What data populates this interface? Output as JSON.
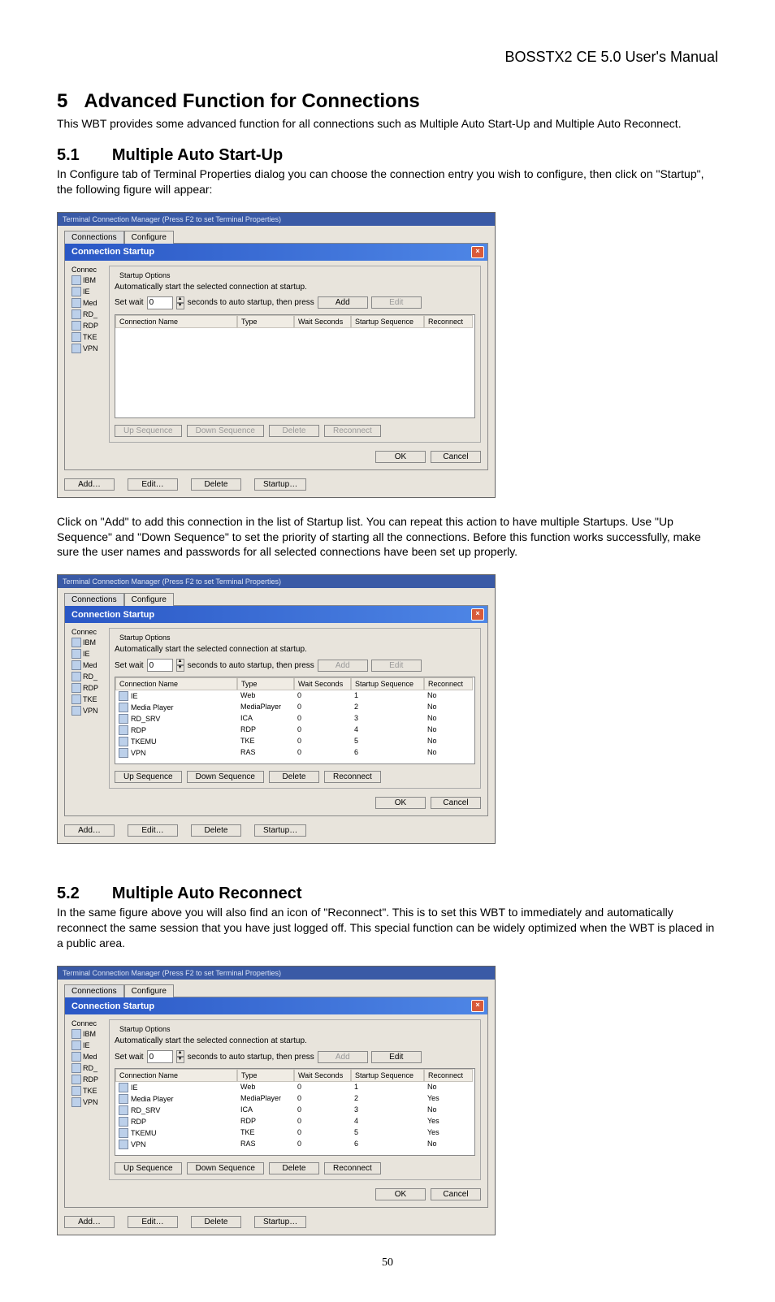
{
  "doc_header": "BOSSTX2 CE 5.0 User's Manual",
  "section5": {
    "num": "5",
    "title": "Advanced Function for Connections",
    "intro": "This WBT provides some advanced function for all connections such as Multiple Auto Start-Up and Multiple Auto Reconnect."
  },
  "section51": {
    "num": "5.1",
    "title": "Multiple Auto Start-Up",
    "intro": "In Configure tab of Terminal Properties dialog you can choose the connection entry you wish to configure, then click on \"Startup\", the following figure will appear:",
    "after": "Click on \"Add\" to add this connection in the list of Startup list. You can repeat this action to have multiple Startups. Use \"Up Sequence\" and \"Down Sequence\" to set the priority of starting all the connections. Before this function works successfully, make sure the user names and passwords for all selected connections have been set up properly."
  },
  "section52": {
    "num": "5.2",
    "title": "Multiple Auto Reconnect",
    "intro": "In the same figure above you will also find an icon of \"Reconnect\". This is to set this WBT to immediately and automatically reconnect the same session that you have just logged off. This special function can be widely optimized when the WBT is placed in a public area."
  },
  "tcm": {
    "window_title": "Terminal Connection Manager  (Press F2 to set Terminal Properties)",
    "tab_connections": "Connections",
    "tab_configure": "Configure",
    "dialog_title": "Connection Startup",
    "group_label": "Startup Options",
    "auto_text": "Automatically start the selected connection at startup.",
    "set_wait_label": "Set wait",
    "set_wait_value": "0",
    "set_wait_tail": "seconds to auto startup, then press",
    "add": "Add",
    "edit": "Edit",
    "list_headers": [
      "Connection Name",
      "Type",
      "Wait Seconds",
      "Startup Sequence",
      "Reconnect"
    ],
    "up_seq": "Up Sequence",
    "down_seq": "Down Sequence",
    "delete": "Delete",
    "reconnect": "Reconnect",
    "ok": "OK",
    "cancel": "Cancel",
    "bottom_add": "Add…",
    "bottom_edit": "Edit…",
    "bottom_delete": "Delete",
    "bottom_startup": "Startup…",
    "left_header": "Connec",
    "left_items": [
      "IBM",
      "IE",
      "Med",
      "RD_",
      "RDP",
      "TKE",
      "VPN"
    ]
  },
  "fig2_rows": [
    {
      "name": "IE",
      "type": "Web",
      "wait": "0",
      "seq": "1",
      "re": "No"
    },
    {
      "name": "Media Player",
      "type": "MediaPlayer",
      "wait": "0",
      "seq": "2",
      "re": "No"
    },
    {
      "name": "RD_SRV",
      "type": "ICA",
      "wait": "0",
      "seq": "3",
      "re": "No"
    },
    {
      "name": "RDP",
      "type": "RDP",
      "wait": "0",
      "seq": "4",
      "re": "No"
    },
    {
      "name": "TKEMU",
      "type": "TKE",
      "wait": "0",
      "seq": "5",
      "re": "No"
    },
    {
      "name": "VPN",
      "type": "RAS",
      "wait": "0",
      "seq": "6",
      "re": "No"
    }
  ],
  "fig3_rows": [
    {
      "name": "IE",
      "type": "Web",
      "wait": "0",
      "seq": "1",
      "re": "No"
    },
    {
      "name": "Media Player",
      "type": "MediaPlayer",
      "wait": "0",
      "seq": "2",
      "re": "Yes"
    },
    {
      "name": "RD_SRV",
      "type": "ICA",
      "wait": "0",
      "seq": "3",
      "re": "No"
    },
    {
      "name": "RDP",
      "type": "RDP",
      "wait": "0",
      "seq": "4",
      "re": "Yes"
    },
    {
      "name": "TKEMU",
      "type": "TKE",
      "wait": "0",
      "seq": "5",
      "re": "Yes"
    },
    {
      "name": "VPN",
      "type": "RAS",
      "wait": "0",
      "seq": "6",
      "re": "No"
    }
  ],
  "page_number": "50"
}
